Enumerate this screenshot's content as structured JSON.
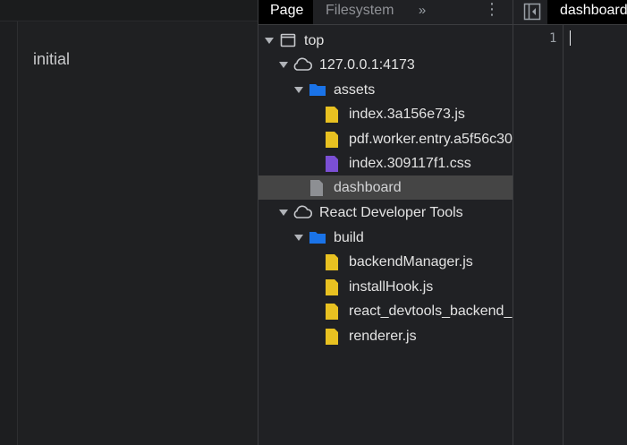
{
  "page": {
    "text": "initial"
  },
  "tabs": {
    "page": "Page",
    "filesystem": "Filesystem",
    "more": "»",
    "menu": "⋮"
  },
  "tree": {
    "top": "top",
    "origin": "127.0.0.1:4173",
    "assets": "assets",
    "files1": [
      "index.3a156e73.js",
      "pdf.worker.entry.a5f56c30",
      "index.309117f1.css"
    ],
    "dashboard": "dashboard",
    "ext": "React Developer Tools",
    "build": "build",
    "files2": [
      "backendManager.js",
      "installHook.js",
      "react_devtools_backend_c",
      "renderer.js"
    ]
  },
  "editor": {
    "tab": "dashboard",
    "line": "1"
  },
  "colors": {
    "folder": "#1a73e8",
    "js": "#e8c121",
    "css": "#7b4fd4",
    "doc": "#8d8f93",
    "selected": "#454545"
  },
  "icons": {
    "top": "frame-icon",
    "origin": "cloud-icon",
    "folder": "folder-icon",
    "js": "js-file-icon",
    "css": "css-file-icon",
    "doc": "document-icon"
  }
}
